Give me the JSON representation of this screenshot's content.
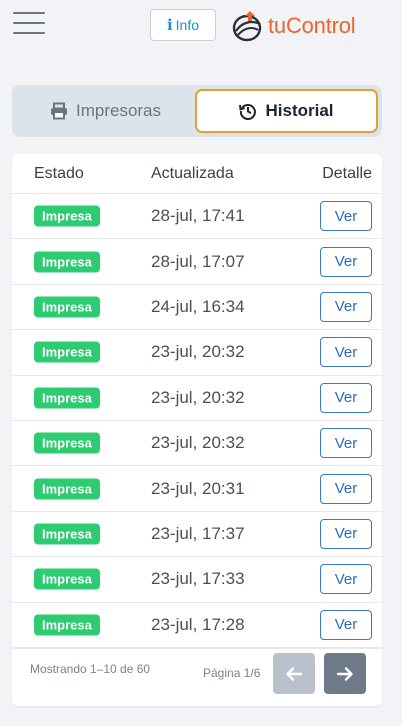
{
  "header": {
    "info_label": "Info",
    "logo_text": "tuControl"
  },
  "tabs": [
    {
      "label": "Impresoras",
      "icon": "printer-icon",
      "active": false
    },
    {
      "label": "Historial",
      "icon": "history-icon",
      "active": true
    }
  ],
  "table": {
    "columns": [
      "Estado",
      "Actualizada",
      "Detalle"
    ],
    "rows": [
      {
        "status": "Impresa",
        "date": "28-jul, 17:41",
        "action": "Ver"
      },
      {
        "status": "Impresa",
        "date": "28-jul, 17:07",
        "action": "Ver"
      },
      {
        "status": "Impresa",
        "date": "24-jul, 16:34",
        "action": "Ver"
      },
      {
        "status": "Impresa",
        "date": "23-jul, 20:32",
        "action": "Ver"
      },
      {
        "status": "Impresa",
        "date": "23-jul, 20:32",
        "action": "Ver"
      },
      {
        "status": "Impresa",
        "date": "23-jul, 20:32",
        "action": "Ver"
      },
      {
        "status": "Impresa",
        "date": "23-jul, 20:31",
        "action": "Ver"
      },
      {
        "status": "Impresa",
        "date": "23-jul, 17:37",
        "action": "Ver"
      },
      {
        "status": "Impresa",
        "date": "23-jul, 17:33",
        "action": "Ver"
      },
      {
        "status": "Impresa",
        "date": "23-jul, 17:28",
        "action": "Ver"
      }
    ]
  },
  "pagination": {
    "showing_text": "Mostrando 1–10 de 60",
    "page_text": "Página 1/6"
  },
  "colors": {
    "accent_border": "#e0a331",
    "status_green": "#2ecc71",
    "link_blue": "#2c6bc1",
    "brand_orange": "#f0622a"
  }
}
